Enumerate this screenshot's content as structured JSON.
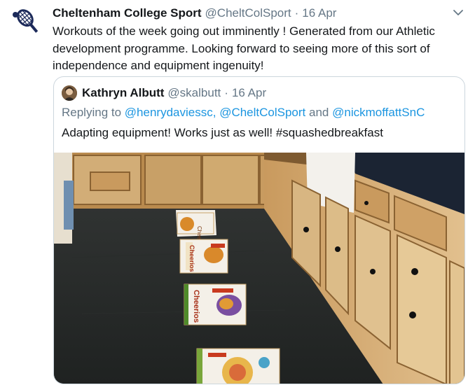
{
  "tweet": {
    "author_name": "Cheltenham College Sport",
    "author_handle": "@CheltColSport",
    "separator": "·",
    "time": "16 Apr",
    "text": "Workouts of the week going out imminently ! Generated from our Athletic development programme. Looking forward to seeing more of this sort of independence and equipment ingenuity!",
    "avatar_icon": "tennis-racket-icon",
    "menu_icon": "chevron-down-icon"
  },
  "quoted": {
    "author_name": "Kathryn Albutt",
    "author_handle": "@skalbutt",
    "separator": "·",
    "time": "16 Apr",
    "reply_prefix": "Replying to",
    "mentions": [
      "@henrydaviessc,",
      "@CheltColSport",
      "@nickmoffattSnC"
    ],
    "mention_joiner": "and",
    "text": "Adapting equipment! Works just as well! #squashedbreakfast",
    "image_box_labels": [
      "Cheerios",
      "Cheerios",
      "Cheerios"
    ]
  },
  "colors": {
    "text_primary": "#14171a",
    "text_secondary": "#657786",
    "link": "#1b95e0",
    "border": "#ccd6dd",
    "brand_navy": "#1c2a5a"
  }
}
